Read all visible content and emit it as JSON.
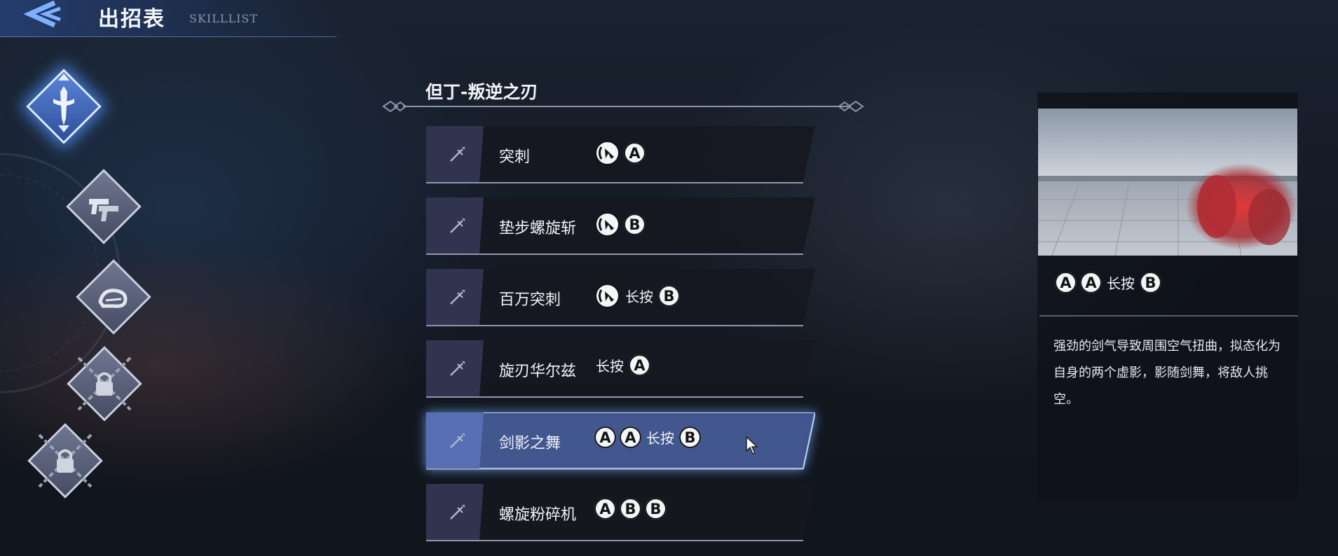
{
  "header": {
    "title": "出招表",
    "subtitle": "SKILLLIST"
  },
  "categories": [
    {
      "icon": "sword-emblem-icon",
      "active": true
    },
    {
      "icon": "twin-pistols-icon",
      "active": false
    },
    {
      "icon": "gauntlet-icon",
      "active": false
    },
    {
      "icon": "chained-lock-icon",
      "active": false
    },
    {
      "icon": "chained-lock-icon",
      "active": false
    }
  ],
  "skill_list": {
    "title": "但丁-叛逆之刃",
    "rows": [
      {
        "name": "突刺",
        "inputs": [
          "dir",
          "A"
        ]
      },
      {
        "name": "垫步螺旋斩",
        "inputs": [
          "dir",
          "B"
        ]
      },
      {
        "name": "百万突刺",
        "inputs": [
          "dir",
          "长按",
          "B"
        ]
      },
      {
        "name": "旋刃华尔兹",
        "inputs": [
          "长按",
          "A"
        ]
      },
      {
        "name": "剑影之舞",
        "inputs": [
          "A",
          "A",
          "长按",
          "B"
        ],
        "selected": true
      },
      {
        "name": "螺旋粉碎机",
        "inputs": [
          "A",
          "B",
          "B"
        ]
      }
    ]
  },
  "detail": {
    "inputs": [
      "A",
      "A",
      "长按",
      "B"
    ],
    "description": "强劲的剑气导致周围空气扭曲，拟态化为自身的两个虚影，影随剑舞，将敌人挑空。"
  },
  "colors": {
    "accent": "#4a8cff",
    "selected_row": "#42548c",
    "button_face": "#f4f5f8"
  }
}
